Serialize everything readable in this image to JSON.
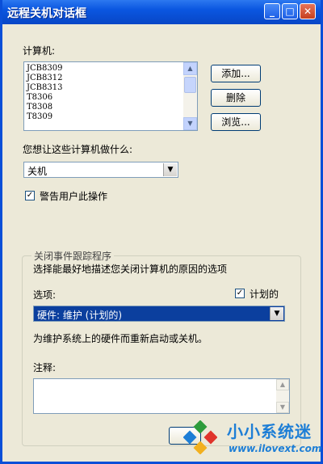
{
  "window": {
    "title": "远程关机对话框",
    "controls": {
      "minimize": "_",
      "maximize": "□",
      "close": "✕"
    }
  },
  "computers": {
    "label": "计算机:",
    "items": [
      "JCB8309",
      "JCB8312",
      "JCB8313",
      "T8306",
      "T8308",
      "T8309"
    ],
    "add_button": "添加...",
    "remove_button": "删除",
    "browse_button": "浏览..."
  },
  "action": {
    "label": "您想让这些计算机做什么:",
    "selected": "关机"
  },
  "warn": {
    "checked": true,
    "label": "警告用户此操作"
  },
  "tracker": {
    "legend": "关闭事件跟踪程序",
    "description": "选择能最好地描述您关闭计算机的原因的选项",
    "option_label": "选项:",
    "planned_label": "计划的",
    "planned_checked": true,
    "selected_option": "硬件: 维护 (计划的)",
    "option_description": "为维护系统上的硬件而重新启动或关机。",
    "comment_label": "注释:",
    "comment_value": ""
  },
  "watermark": {
    "title": "小小系统迷",
    "url": "www.ilovext.com"
  },
  "colors": {
    "titlebar": "#0a56e0",
    "selection": "#0b3f9e",
    "dialog_bg": "#ece9d8",
    "watermark": "#1d7ed6"
  }
}
